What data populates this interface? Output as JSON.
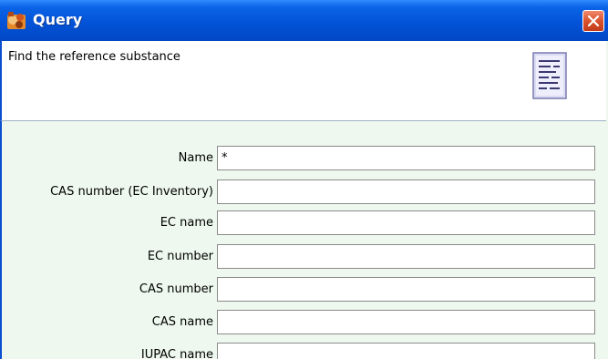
{
  "window": {
    "title": "Query",
    "app_icon": "app-icon",
    "close_icon": "close-icon"
  },
  "header": {
    "text": "Find the reference substance",
    "icon": "document-list-icon"
  },
  "form": {
    "fields": [
      {
        "label": "Name",
        "value": "*"
      },
      {
        "label": "CAS number (EC Inventory)",
        "value": ""
      },
      {
        "label": "EC name",
        "value": ""
      },
      {
        "label": "EC number",
        "value": ""
      },
      {
        "label": "CAS number",
        "value": ""
      },
      {
        "label": "CAS name",
        "value": ""
      },
      {
        "label": "IUPAC name",
        "value": ""
      }
    ]
  },
  "colors": {
    "titlebar": "#0353d8",
    "close_button": "#d9532e",
    "form_background": "#eef8ee",
    "header_background": "#ffffff"
  }
}
